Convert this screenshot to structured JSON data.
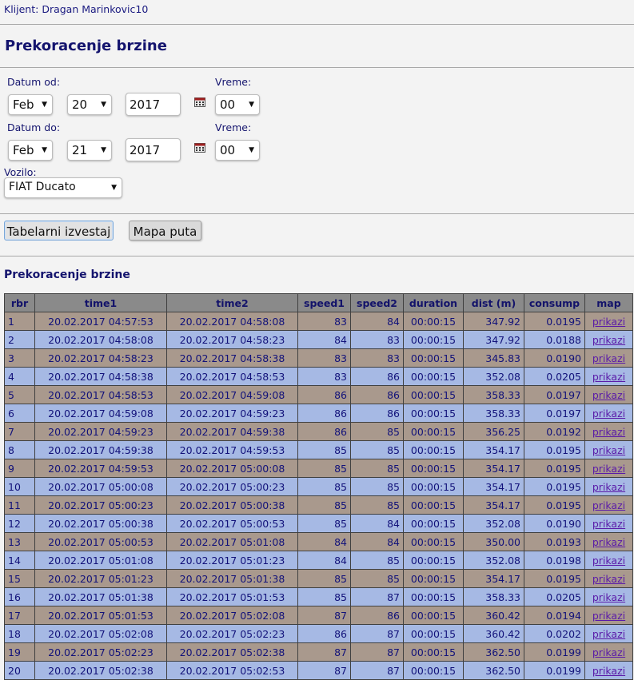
{
  "client": "Klijent: Dragan Marinkovic10",
  "page_title": "Prekoracenje brzine",
  "filters": {
    "date_from_label": "Datum od:",
    "date_to_label": "Datum do:",
    "time_label": "Vreme:",
    "vehicle_label": "Vozilo:",
    "from": {
      "month": "Feb",
      "day": "20",
      "year": "2017",
      "hour": "00"
    },
    "to": {
      "month": "Feb",
      "day": "21",
      "year": "2017",
      "hour": "00"
    },
    "vehicle": "FIAT Ducato"
  },
  "buttons": {
    "table_report": "Tabelarni izvestaj",
    "route_map": "Mapa puta"
  },
  "report_title": "Prekoracenje brzine",
  "table": {
    "headers": [
      "rbr",
      "time1",
      "time2",
      "speed1",
      "speed2",
      "duration",
      "dist (m)",
      "consump",
      "map"
    ],
    "rows": [
      [
        "1",
        "20.02.2017 04:57:53",
        "20.02.2017 04:58:08",
        "83",
        "84",
        "00:00:15",
        "347.92",
        "0.0195",
        "prikazi"
      ],
      [
        "2",
        "20.02.2017 04:58:08",
        "20.02.2017 04:58:23",
        "84",
        "83",
        "00:00:15",
        "347.92",
        "0.0188",
        "prikazi"
      ],
      [
        "3",
        "20.02.2017 04:58:23",
        "20.02.2017 04:58:38",
        "83",
        "83",
        "00:00:15",
        "345.83",
        "0.0190",
        "prikazi"
      ],
      [
        "4",
        "20.02.2017 04:58:38",
        "20.02.2017 04:58:53",
        "83",
        "86",
        "00:00:15",
        "352.08",
        "0.0205",
        "prikazi"
      ],
      [
        "5",
        "20.02.2017 04:58:53",
        "20.02.2017 04:59:08",
        "86",
        "86",
        "00:00:15",
        "358.33",
        "0.0197",
        "prikazi"
      ],
      [
        "6",
        "20.02.2017 04:59:08",
        "20.02.2017 04:59:23",
        "86",
        "86",
        "00:00:15",
        "358.33",
        "0.0197",
        "prikazi"
      ],
      [
        "7",
        "20.02.2017 04:59:23",
        "20.02.2017 04:59:38",
        "86",
        "85",
        "00:00:15",
        "356.25",
        "0.0192",
        "prikazi"
      ],
      [
        "8",
        "20.02.2017 04:59:38",
        "20.02.2017 04:59:53",
        "85",
        "85",
        "00:00:15",
        "354.17",
        "0.0195",
        "prikazi"
      ],
      [
        "9",
        "20.02.2017 04:59:53",
        "20.02.2017 05:00:08",
        "85",
        "85",
        "00:00:15",
        "354.17",
        "0.0195",
        "prikazi"
      ],
      [
        "10",
        "20.02.2017 05:00:08",
        "20.02.2017 05:00:23",
        "85",
        "85",
        "00:00:15",
        "354.17",
        "0.0195",
        "prikazi"
      ],
      [
        "11",
        "20.02.2017 05:00:23",
        "20.02.2017 05:00:38",
        "85",
        "85",
        "00:00:15",
        "354.17",
        "0.0195",
        "prikazi"
      ],
      [
        "12",
        "20.02.2017 05:00:38",
        "20.02.2017 05:00:53",
        "85",
        "84",
        "00:00:15",
        "352.08",
        "0.0190",
        "prikazi"
      ],
      [
        "13",
        "20.02.2017 05:00:53",
        "20.02.2017 05:01:08",
        "84",
        "84",
        "00:00:15",
        "350.00",
        "0.0193",
        "prikazi"
      ],
      [
        "14",
        "20.02.2017 05:01:08",
        "20.02.2017 05:01:23",
        "84",
        "85",
        "00:00:15",
        "352.08",
        "0.0198",
        "prikazi"
      ],
      [
        "15",
        "20.02.2017 05:01:23",
        "20.02.2017 05:01:38",
        "85",
        "85",
        "00:00:15",
        "354.17",
        "0.0195",
        "prikazi"
      ],
      [
        "16",
        "20.02.2017 05:01:38",
        "20.02.2017 05:01:53",
        "85",
        "87",
        "00:00:15",
        "358.33",
        "0.0205",
        "prikazi"
      ],
      [
        "17",
        "20.02.2017 05:01:53",
        "20.02.2017 05:02:08",
        "87",
        "86",
        "00:00:15",
        "360.42",
        "0.0194",
        "prikazi"
      ],
      [
        "18",
        "20.02.2017 05:02:08",
        "20.02.2017 05:02:23",
        "86",
        "87",
        "00:00:15",
        "360.42",
        "0.0202",
        "prikazi"
      ],
      [
        "19",
        "20.02.2017 05:02:23",
        "20.02.2017 05:02:38",
        "87",
        "87",
        "00:00:15",
        "362.50",
        "0.0199",
        "prikazi"
      ],
      [
        "20",
        "20.02.2017 05:02:38",
        "20.02.2017 05:02:53",
        "87",
        "87",
        "00:00:15",
        "362.50",
        "0.0199",
        "prikazi"
      ]
    ]
  },
  "colors": {
    "row_odd": "#a9998d",
    "row_even": "#a6b9e4",
    "header": "#8a8a8a",
    "text": "#12127a",
    "link": "#5a1aa8"
  }
}
